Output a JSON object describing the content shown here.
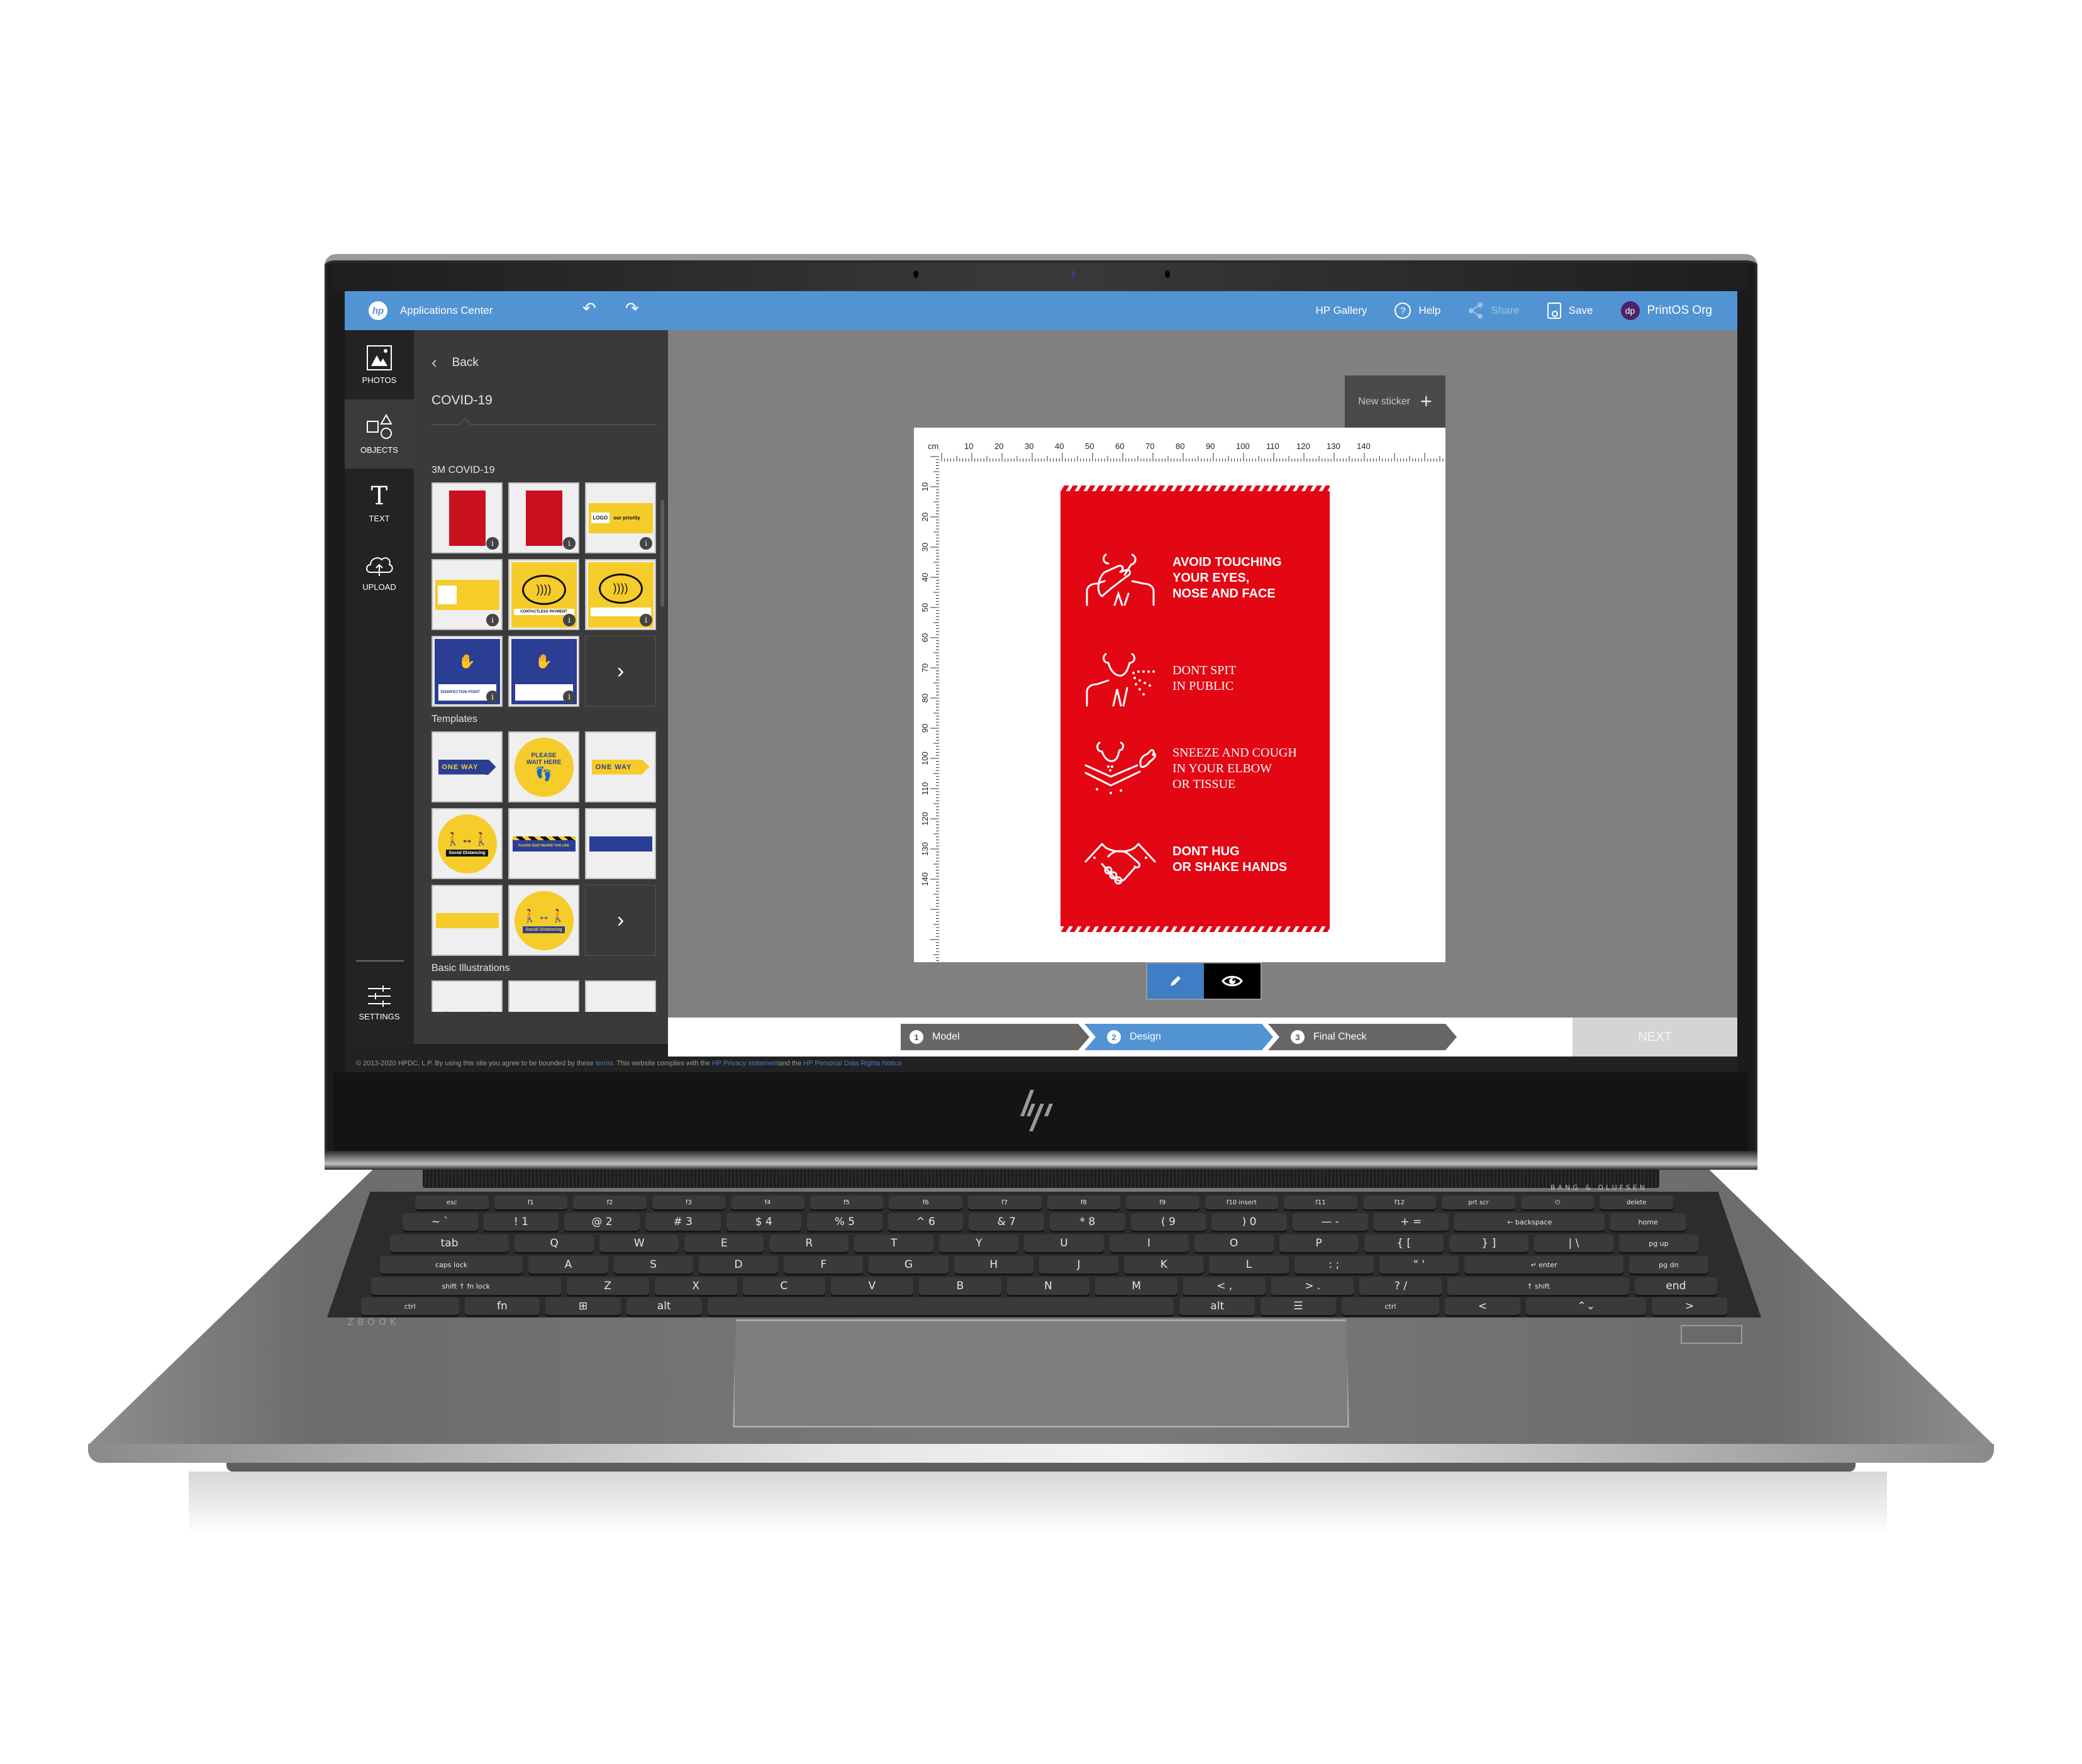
{
  "header": {
    "logo": "hp",
    "app_title": "Applications Center",
    "undo_icon": "↶",
    "redo_icon": "↷",
    "gallery_label": "HP Gallery",
    "help_label": "Help",
    "share_label": "Share",
    "save_label": "Save",
    "avatar_initials": "dp",
    "org_name": "PrintOS Org"
  },
  "rail": {
    "items": [
      {
        "label": "PHOTOS",
        "icon": "photo-icon"
      },
      {
        "label": "OBJECTS",
        "icon": "shapes-icon"
      },
      {
        "label": "TEXT",
        "icon": "text-icon"
      },
      {
        "label": "UPLOAD",
        "icon": "cloud-upload-icon"
      }
    ],
    "settings_label": "SETTINGS",
    "active": "OBJECTS"
  },
  "panel": {
    "back_label": "Back",
    "title": "COVID-19",
    "sections": [
      {
        "title": "3M COVID-19",
        "thumbs": [
          {
            "kind": "red-sign-text",
            "info": true
          },
          {
            "kind": "red-sign-icons",
            "info": true
          },
          {
            "kind": "logo-priority",
            "text": "our priority",
            "logo": "LOGO",
            "info": true
          },
          {
            "kind": "yellow-blank",
            "info": true
          },
          {
            "kind": "contactless",
            "caption": "CONTACTLESS PAYMENT",
            "info": true
          },
          {
            "kind": "contactless-blank",
            "info": true
          },
          {
            "kind": "disinfection",
            "caption": "DISINFECTION POINT",
            "info": true
          },
          {
            "kind": "disinfection-blank",
            "info": true
          },
          {
            "kind": "more"
          }
        ]
      },
      {
        "title": "Templates",
        "thumbs": [
          {
            "kind": "one-way-blue",
            "text": "ONE WAY"
          },
          {
            "kind": "please-wait",
            "text": "PLEASE WAIT HERE"
          },
          {
            "kind": "one-way-yellow",
            "text": "ONE WAY"
          },
          {
            "kind": "social-distancing-black",
            "text": "Social Distancing"
          },
          {
            "kind": "keep-behind",
            "text": "PLEASE KEEP BEHIND THIS LINE"
          },
          {
            "kind": "strip-blue"
          },
          {
            "kind": "strip-yellow"
          },
          {
            "kind": "social-distancing-blue",
            "text": "Social Distancing"
          },
          {
            "kind": "more"
          }
        ]
      },
      {
        "title": "Basic Illustrations",
        "thumbs": [
          {
            "kind": "illus-footprints"
          },
          {
            "kind": "illus-people"
          },
          {
            "kind": "illus-cloud"
          }
        ]
      }
    ],
    "info_glyph": "i",
    "more_glyph": "›"
  },
  "canvas": {
    "new_sticker_label": "New sticker",
    "new_sticker_icon": "+",
    "ruler_unit": "cm",
    "ruler_top_ticks": [
      10,
      20,
      30,
      40,
      50,
      60,
      70,
      80,
      90,
      100,
      110,
      120,
      130,
      140
    ],
    "ruler_left_ticks": [
      10,
      20,
      30,
      40,
      50,
      60,
      70,
      80,
      90,
      100,
      110,
      120,
      130,
      140
    ],
    "sign": {
      "color": "#e30613",
      "rows": [
        {
          "icon": "face-touch-icon",
          "text": "AVOID TOUCHING\nYOUR EYES,\nNOSE AND FACE",
          "style": "sans"
        },
        {
          "icon": "spit-icon",
          "text": "DONT SPIT\nIN PUBLIC",
          "style": "serif"
        },
        {
          "icon": "sneeze-elbow-icon",
          "text": "SNEEZE AND COUGH\nIN YOUR ELBOW\nOR TISSUE",
          "style": "serif"
        },
        {
          "icon": "handshake-icon",
          "text": "DONT HUG\nOR SHAKE HANDS",
          "style": "sans"
        }
      ]
    },
    "mode": "edit"
  },
  "stepper": {
    "steps": [
      {
        "num": "1",
        "label": "Model",
        "state": "done"
      },
      {
        "num": "2",
        "label": "Design",
        "state": "active"
      },
      {
        "num": "3",
        "label": "Final Check",
        "state": "pending"
      }
    ],
    "next_label": "NEXT",
    "next_enabled": false
  },
  "footer": {
    "prefix": "© 2013-2020 HPDC, L.P. By using this site you agree to be bounded by these ",
    "terms_link": "terms",
    "middle": ". This website complies with the ",
    "privacy_link": "HP Privacy statement",
    "and": "and the ",
    "rights_link": "HP Personal Data Rights Notice"
  },
  "colors": {
    "header_blue": "#5294d3",
    "step_active": "#5294d3",
    "edit_button": "#3f7dc4",
    "avatar": "#4b2366",
    "sign_red": "#e30613"
  },
  "hardware": {
    "chin_logo": "hp",
    "speaker_brand": "BANG & OLUFSEN",
    "model_mark": "ZBOOK",
    "keyboard_rows": [
      [
        "esc",
        "f1",
        "f2",
        "f3",
        "f4",
        "f5",
        "f6",
        "f7",
        "f8",
        "f9",
        "f10 insert",
        "f11",
        "f12",
        "prt scr",
        "⏻",
        "delete"
      ],
      [
        "~ `",
        "! 1",
        "@ 2",
        "# 3",
        "$ 4",
        "% 5",
        "^ 6",
        "& 7",
        "* 8",
        "( 9",
        ") 0",
        "— -",
        "+ =",
        "← backspace",
        "home"
      ],
      [
        "tab",
        "Q",
        "W",
        "E",
        "R",
        "T",
        "Y",
        "U",
        "I",
        "O",
        "P",
        "{ [",
        "} ]",
        "| \\",
        "pg up"
      ],
      [
        "caps lock",
        "A",
        "S",
        "D",
        "F",
        "G",
        "H",
        "J",
        "K",
        "L",
        ": ;",
        "\" '",
        "↵ enter",
        "pg dn"
      ],
      [
        "shift ↑  fn lock",
        "Z",
        "X",
        "C",
        "V",
        "B",
        "N",
        "M",
        "< ,",
        "> .",
        "? /",
        "↑ shift",
        "end"
      ],
      [
        "ctrl",
        "fn",
        "⊞",
        "alt",
        "",
        "alt",
        "☰",
        "ctrl",
        "<",
        "⌃⌄",
        ">"
      ]
    ]
  }
}
